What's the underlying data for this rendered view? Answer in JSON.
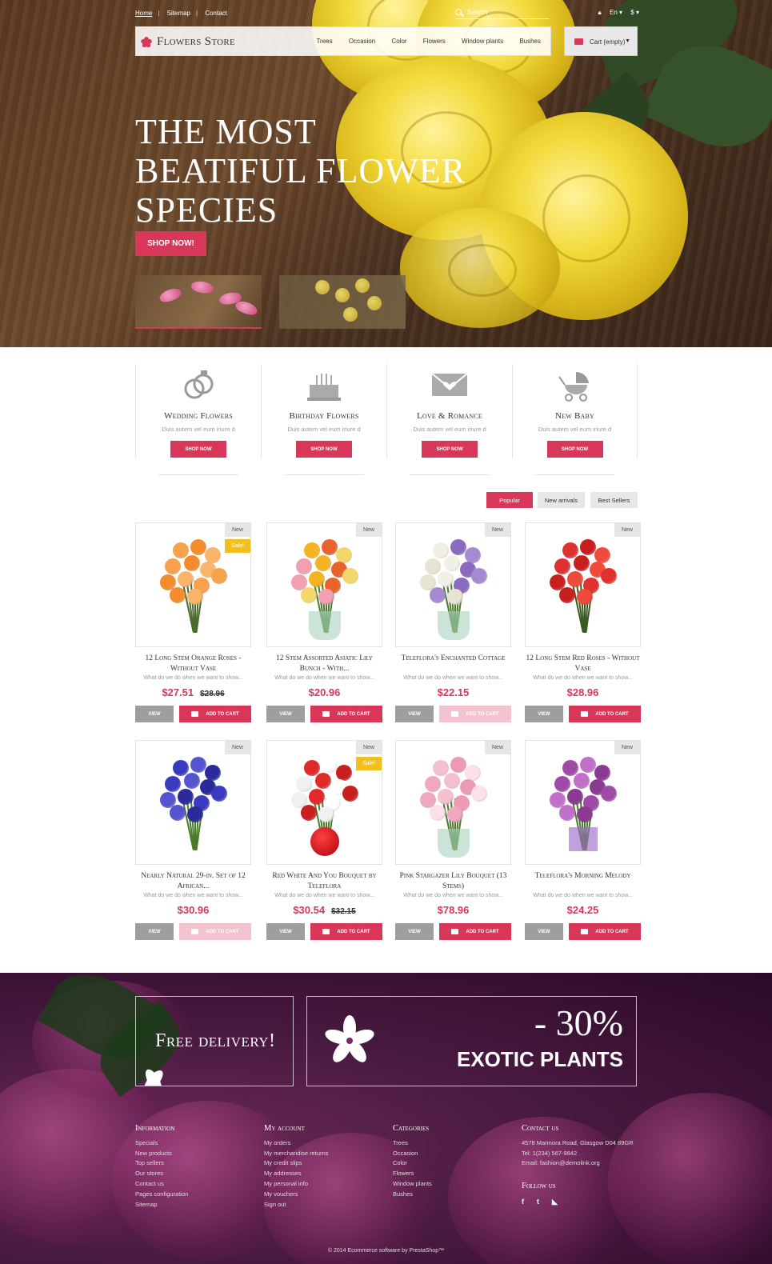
{
  "topbar": {
    "links": [
      "Home",
      "Sitemap",
      "Contact"
    ],
    "search_placeholder": "Search",
    "language": "En",
    "currency": "$"
  },
  "header": {
    "logo": "Flowers Store",
    "menu": [
      "Trees",
      "Occasion",
      "Color",
      "Flowers",
      "Window plants",
      "Bushes"
    ],
    "cart_label": "Cart (empty)"
  },
  "hero": {
    "line1": "THE MOST",
    "line2": "BEATIFUL FLOWER",
    "line3": "SPECIES",
    "button": "SHOP NOW!"
  },
  "categories": [
    {
      "name": "Wedding Flowers",
      "desc": "Duis autem vel eum iriure d",
      "button": "SHOP NOW",
      "icon": "rings-icon"
    },
    {
      "name": "Birthday Flowers",
      "desc": "Duis autem vel eum iriure d",
      "button": "SHOP NOW",
      "icon": "cake-icon"
    },
    {
      "name": "Love & Romance",
      "desc": "Duis autem vel eum iriure d",
      "button": "SHOP NOW",
      "icon": "envelope-heart-icon"
    },
    {
      "name": "New Baby",
      "desc": "Duis autem vel eum iriure d",
      "button": "SHOP NOW",
      "icon": "stroller-icon"
    }
  ],
  "tabs": [
    "Popular",
    "New arrivals",
    "Best Sellers"
  ],
  "products": [
    {
      "name": "12 Long Stem Orange Roses - Without Vase",
      "desc": "What do we do when we want to show...",
      "price": "$27.51",
      "old": "$28.96",
      "badge": "New",
      "sale": "Sale!",
      "view": "VIEW",
      "add": "ADD TO CART"
    },
    {
      "name": "12 Stem Assorted Asiatic Lily Bunch - With...",
      "desc": "What do we do when we want to show...",
      "price": "$20.96",
      "old": "",
      "badge": "New",
      "sale": "",
      "view": "VIEW",
      "add": "ADD TO CART"
    },
    {
      "name": "Teleflora's Enchanted Cottage",
      "desc": "What do we do when we want to show...",
      "price": "$22.15",
      "old": "",
      "badge": "New",
      "sale": "",
      "view": "VIEW",
      "add": "ADD TO CART"
    },
    {
      "name": "12 Long Stem Red Roses - Without Vase",
      "desc": "What do we do when we want to show...",
      "price": "$28.96",
      "old": "",
      "badge": "New",
      "sale": "",
      "view": "VIEW",
      "add": "ADD TO CART"
    },
    {
      "name": "Nearly Natural 29-in. Set of 12 African...",
      "desc": "What do we do when we want to show...",
      "price": "$30.96",
      "old": "",
      "badge": "New",
      "sale": "",
      "view": "VIEW",
      "add": "ADD TO CART"
    },
    {
      "name": "Red White And You Bouquet by Teleflora",
      "desc": "What do we do when we want to show...",
      "price": "$30.54",
      "old": "$32.15",
      "badge": "New",
      "sale": "Sale!",
      "view": "VIEW",
      "add": "ADD TO CART"
    },
    {
      "name": "Pink Stargazer Lily Bouquet (13 Stems)",
      "desc": "What do we do when we want to show...",
      "price": "$78.96",
      "old": "",
      "badge": "New",
      "sale": "",
      "view": "VIEW",
      "add": "ADD TO CART"
    },
    {
      "name": "Teleflora's Morning Melody",
      "desc": "What do we do when we want to show...",
      "price": "$24.25",
      "old": "",
      "badge": "New",
      "sale": "",
      "view": "VIEW",
      "add": "ADD TO CART"
    }
  ],
  "promo": {
    "delivery": "Free delivery!",
    "discount": "- 30%",
    "exotic": "EXOTIC PLANTS"
  },
  "footer": {
    "information": {
      "title": "Information",
      "items": [
        "Specials",
        "New products",
        "Top sellers",
        "Our stores",
        "Contact us",
        "Pages configuration",
        "Sitemap"
      ]
    },
    "account": {
      "title": "My account",
      "items": [
        "My orders",
        "My merchandise returns",
        "My credit slips",
        "My addresses",
        "My personal info",
        "My vouchers",
        "Sign out"
      ]
    },
    "categories": {
      "title": "Categories",
      "items": [
        "Trees",
        "Occasion",
        "Color",
        "Flowers",
        "Window plants",
        "Bushes"
      ]
    },
    "contact": {
      "title": "Contact us",
      "address": "4578 Marmora Road, Glasgow D04 89GR",
      "tel": "Tel: 1(234) 567-9842",
      "email": "Email: fashion@demolink.org"
    },
    "follow": {
      "title": "Follow us"
    },
    "copyright": "© 2014 Ecommerce software by PrestaShop™"
  },
  "colors": {
    "accent": "#d9375a",
    "sale": "#f0c020"
  }
}
